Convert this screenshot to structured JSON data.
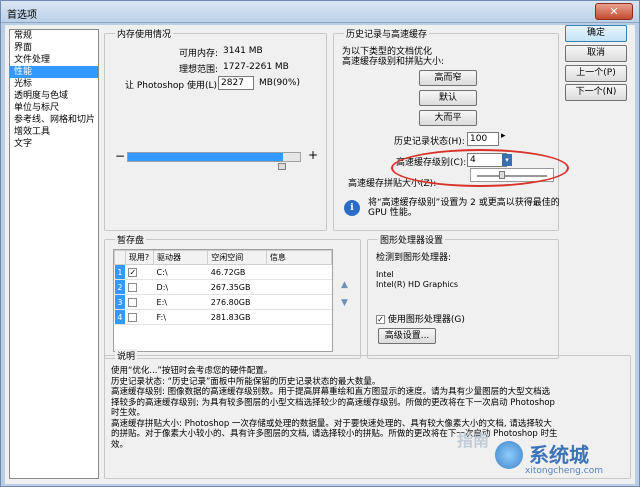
{
  "window": {
    "title": "首选项",
    "close_glyph": "✕"
  },
  "nav": {
    "items": [
      {
        "label": "常规"
      },
      {
        "label": "界面"
      },
      {
        "label": "文件处理"
      },
      {
        "label": "性能",
        "selected": true
      },
      {
        "label": "光标"
      },
      {
        "label": "透明度与色域"
      },
      {
        "label": "单位与标尺"
      },
      {
        "label": "参考线、网格和切片"
      },
      {
        "label": "增效工具"
      },
      {
        "label": "文字"
      }
    ]
  },
  "memory": {
    "legend": "内存使用情况",
    "available_label": "可用内存:",
    "available_value": "3141 MB",
    "ideal_label": "理想范围:",
    "ideal_value": "1727-2261 MB",
    "let_label": "让 Photoshop 使用(L):",
    "let_value": "2827",
    "let_suffix": "MB(90%)",
    "slider_minus": "−",
    "slider_plus": "+",
    "slider_fraction": 0.9
  },
  "history": {
    "legend": "历史记录与高速缓存",
    "intro_line1": "为以下类型的文档优化",
    "intro_line2": "高速缓存级别和拼贴大小:",
    "btn_tall_thin": "高而窄",
    "btn_default": "默认",
    "btn_big_flat": "大而平",
    "states_label": "历史记录状态(H):",
    "states_value": "100",
    "levels_label": "高速缓存级别(C):",
    "levels_value": "4",
    "tile_label": "高速缓存拼贴大小(Z):",
    "info_text_line1": "将“高速缓存级别”设置为 2 或更高以获得最佳的",
    "info_text_line2": "GPU 性能。"
  },
  "scratch": {
    "legend": "暂存盘",
    "headers": [
      "",
      "现用?",
      "驱动器",
      "空闲空间",
      "信息"
    ],
    "rows": [
      {
        "idx": "1",
        "active": "✓",
        "drive": "C:\\",
        "free": "46.72GB",
        "info": ""
      },
      {
        "idx": "2",
        "active": "",
        "drive": "D:\\",
        "free": "267.35GB",
        "info": ""
      },
      {
        "idx": "3",
        "active": "",
        "drive": "E:\\",
        "free": "276.80GB",
        "info": ""
      },
      {
        "idx": "4",
        "active": "",
        "drive": "F:\\",
        "free": "281.83GB",
        "info": ""
      }
    ]
  },
  "gpu": {
    "legend": "图形处理器设置",
    "detected_label": "检测到图形处理器:",
    "vendor": "Intel",
    "model": "Intel(R) HD Graphics",
    "use_label": "使用图形处理器(G)",
    "use_checked_glyph": "✓",
    "advanced_btn": "高级设置..."
  },
  "buttons": {
    "ok": "确定",
    "cancel": "取消",
    "prev": "上一个(P)",
    "next": "下一个(N)"
  },
  "description": {
    "legend": "说明",
    "lines": [
      "使用“优化...”按钮时会考虑您的硬件配置。",
      "历史记录状态: “历史记录”面板中所能保留的历史记录状态的最大数量。",
      "高速缓存级别: 图像数据的高速缓存级别数。用于提高屏幕重绘和直方图显示的速度。请为具有少量图层的大型文档选",
      "择较多的高速缓存级别; 为具有较多图层的小型文档选择较少的高速缓存级别。所做的更改将在下一次启动 Photoshop",
      "时生效。",
      "高速缓存拼贴大小: Photoshop 一次存储或处理的数据量。对于要快速处理的、具有较大像素大小的文档, 请选择较大",
      "的拼贴。对于像素大小较小的、具有许多图层的文档, 请选择较小的拼贴。所做的更改将在下一次启动 Photoshop 时生",
      "效。"
    ]
  },
  "watermark": {
    "site_cn": "系统城",
    "site_en": "xitongcheng.com",
    "overlay": "指南"
  },
  "colors": {
    "selection": "#3399ff",
    "accent_red": "#d9322a"
  }
}
